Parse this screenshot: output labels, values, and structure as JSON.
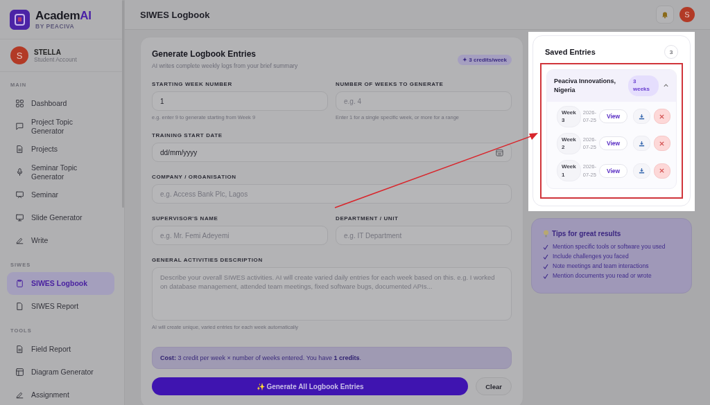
{
  "brand": {
    "name": "Academ",
    "accent": "AI",
    "tagline": "BY PEACIVA"
  },
  "user": {
    "initial": "S",
    "name": "STELLA",
    "role": "Student Account"
  },
  "sidebar": {
    "sections": [
      {
        "title": "MAIN",
        "items": [
          {
            "label": "Dashboard",
            "selected": false
          },
          {
            "label": "Project Topic Generator",
            "selected": false
          },
          {
            "label": "Projects",
            "selected": false
          },
          {
            "label": "Seminar Topic Generator",
            "selected": false
          },
          {
            "label": "Seminar",
            "selected": false
          },
          {
            "label": "Slide Generator",
            "selected": false
          },
          {
            "label": "Write",
            "selected": false
          }
        ]
      },
      {
        "title": "SIWES",
        "items": [
          {
            "label": "SIWES Logbook",
            "selected": true
          },
          {
            "label": "SIWES Report",
            "selected": false
          }
        ]
      },
      {
        "title": "TOOLS",
        "items": [
          {
            "label": "Field Report",
            "selected": false
          },
          {
            "label": "Diagram Generator",
            "selected": false
          },
          {
            "label": "Assignment",
            "selected": false
          }
        ]
      }
    ]
  },
  "header": {
    "title": "SIWES Logbook",
    "avatar_initial": "S"
  },
  "form": {
    "title": "Generate Logbook Entries",
    "subtitle": "AI writes complete weekly logs from your brief summary",
    "badge": "✦ 3 credits/week",
    "rows": [
      [
        {
          "kind": "input",
          "label": "STARTING WEEK NUMBER",
          "value": "1",
          "hint": "e.g. enter 9 to generate starting from Week 9"
        },
        {
          "kind": "input",
          "label": "NUMBER OF WEEKS TO GENERATE",
          "placeholder": "e.g. 4",
          "hint": "Enter 1 for a single specific week, or more for a range"
        }
      ],
      [
        {
          "kind": "date",
          "label": "TRAINING START DATE",
          "value": "dd/mm/yyyy"
        }
      ],
      [
        {
          "kind": "input",
          "label": "COMPANY / ORGANISATION",
          "placeholder": "e.g. Access Bank Plc, Lagos"
        }
      ],
      [
        {
          "kind": "input",
          "label": "SUPERVISOR'S NAME",
          "placeholder": "e.g. Mr. Femi Adeyemi"
        },
        {
          "kind": "input",
          "label": "DEPARTMENT / UNIT",
          "placeholder": "e.g. IT Department"
        }
      ],
      [
        {
          "kind": "textarea",
          "label": "GENERAL ACTIVITIES DESCRIPTION",
          "placeholder": "Describe your overall SIWES activities. AI will create varied daily entries for each week based on this. e.g. I worked on database management, attended team meetings, fixed software bugs, documented APIs...",
          "hint": "AI will create unique, varied entries for each week automatically"
        }
      ]
    ],
    "cost_note": "**Cost:** 3 credit per week × number of weeks entered. You have **1 credits**.",
    "generate_button": "✨ Generate All Logbook Entries",
    "clear_button": "Clear"
  },
  "saved": {
    "title": "Saved Entries",
    "count": "3",
    "groups": [
      {
        "name": "Peaciva Innovations, Nigeria",
        "badge": "3 weeks",
        "expanded": true,
        "entries": [
          {
            "week": "Week 3",
            "date": "2026-07-25",
            "view": "View"
          },
          {
            "week": "Week 2",
            "date": "2026-07-25",
            "view": "View"
          },
          {
            "week": "Week 1",
            "date": "2026-07-25",
            "view": "View"
          }
        ]
      }
    ]
  },
  "tips": {
    "title": "Tips for great results",
    "items": [
      "Mention specific tools or software you used",
      "Include challenges you faced",
      "Note meetings and team interactions",
      "Mention documents you read or wrote"
    ]
  }
}
